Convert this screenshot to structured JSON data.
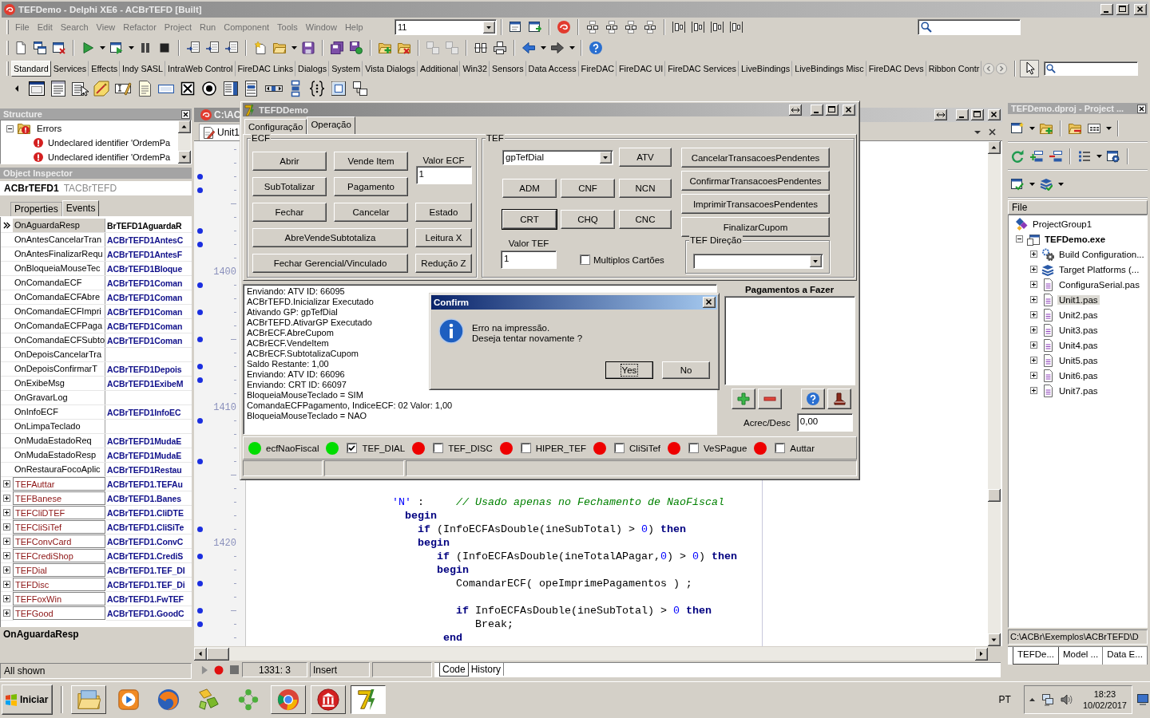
{
  "window": {
    "title": "TEFDemo - Delphi XE6 - ACBrTEFD [Built]"
  },
  "menu": [
    {
      "label": "File",
      "disabled": true
    },
    {
      "label": "Edit",
      "disabled": true
    },
    {
      "label": "Search",
      "disabled": true
    },
    {
      "label": "View",
      "disabled": true
    },
    {
      "label": "Refactor",
      "disabled": true
    },
    {
      "label": "Project",
      "disabled": true
    },
    {
      "label": "Run",
      "disabled": true
    },
    {
      "label": "Component",
      "disabled": true
    },
    {
      "label": "Tools",
      "disabled": true
    },
    {
      "label": "Window",
      "disabled": true
    },
    {
      "label": "Help",
      "disabled": true
    }
  ],
  "toolbar": {
    "build_combo": "11"
  },
  "palette": {
    "tabs": [
      {
        "label": "Standard",
        "selected": true
      },
      {
        "label": "Services",
        "selected": false
      },
      {
        "label": "Effects",
        "selected": false
      },
      {
        "label": "Indy SASL",
        "selected": false
      },
      {
        "label": "IntraWeb Control",
        "selected": false
      },
      {
        "label": "FireDAC Links",
        "selected": false
      },
      {
        "label": "Dialogs",
        "selected": false
      },
      {
        "label": "System",
        "selected": false
      },
      {
        "label": "Vista Dialogs",
        "selected": false
      },
      {
        "label": "Additional",
        "selected": false
      },
      {
        "label": "Win32",
        "selected": false
      },
      {
        "label": "Sensors",
        "selected": false
      },
      {
        "label": "Data Access",
        "selected": false
      },
      {
        "label": "FireDAC",
        "selected": false
      },
      {
        "label": "FireDAC UI",
        "selected": false
      },
      {
        "label": "FireDAC Services",
        "selected": false
      },
      {
        "label": "LiveBindings",
        "selected": false
      },
      {
        "label": "LiveBindings Misc",
        "selected": false
      },
      {
        "label": "FireDAC Devs",
        "selected": false
      },
      {
        "label": "Ribbon Contr",
        "selected": false
      }
    ]
  },
  "structure": {
    "title": "Structure",
    "tree": [
      {
        "label": "Errors",
        "expanded": true,
        "children": [
          {
            "label": "Undeclared identifier 'OrdemPa"
          },
          {
            "label": "Undeclared identifier 'OrdemPa"
          }
        ]
      }
    ]
  },
  "object_inspector": {
    "title": "Object Inspector",
    "component": "ACBrTEFD1",
    "component_class": "TACBrTEFD",
    "tabs": [
      {
        "label": "Properties",
        "selected": false
      },
      {
        "label": "Events",
        "selected": true
      }
    ],
    "rows": [
      {
        "kind": "event",
        "name": "OnAguardaResp",
        "value": "BrTEFD1AguardaR",
        "selected": true
      },
      {
        "kind": "event",
        "name": "OnAntesCancelarTran",
        "value": "ACBrTEFD1AntesC",
        "selected": false
      },
      {
        "kind": "event",
        "name": "OnAntesFinalizarRequ",
        "value": "ACBrTEFD1AntesF",
        "selected": false
      },
      {
        "kind": "event",
        "name": "OnBloqueiaMouseTec",
        "value": "ACBrTEFD1Bloque",
        "selected": false
      },
      {
        "kind": "event",
        "name": "OnComandaECF",
        "value": "ACBrTEFD1Coman",
        "selected": false
      },
      {
        "kind": "event",
        "name": "OnComandaECFAbre",
        "value": "ACBrTEFD1Coman",
        "selected": false
      },
      {
        "kind": "event",
        "name": "OnComandaECFImpri",
        "value": "ACBrTEFD1Coman",
        "selected": false
      },
      {
        "kind": "event",
        "name": "OnComandaECFPaga",
        "value": "ACBrTEFD1Coman",
        "selected": false
      },
      {
        "kind": "event",
        "name": "OnComandaECFSubto",
        "value": "ACBrTEFD1Coman",
        "selected": false
      },
      {
        "kind": "event",
        "name": "OnDepoisCancelarTra",
        "selected": false
      },
      {
        "kind": "event",
        "name": "OnDepoisConfirmarT",
        "value": "ACBrTEFD1Depois",
        "selected": false
      },
      {
        "kind": "event",
        "name": "OnExibeMsg",
        "value": "ACBrTEFD1ExibeM",
        "selected": false
      },
      {
        "kind": "event",
        "name": "OnGravarLog",
        "selected": false
      },
      {
        "kind": "event",
        "name": "OnInfoECF",
        "value": "ACBrTEFD1InfoEC",
        "selected": false
      },
      {
        "kind": "event",
        "name": "OnLimpaTeclado",
        "selected": false
      },
      {
        "kind": "event",
        "name": "OnMudaEstadoReq",
        "value": "ACBrTEFD1MudaE",
        "selected": false
      },
      {
        "kind": "event",
        "name": "OnMudaEstadoResp",
        "value": "ACBrTEFD1MudaE",
        "selected": false
      },
      {
        "kind": "event",
        "name": "OnRestauraFocoAplic",
        "value": "ACBrTEFD1Restau",
        "selected": false
      },
      {
        "kind": "group",
        "name": "TEFAuttar",
        "value": "ACBrTEFD1.TEFAu",
        "expanded": false,
        "selected": false
      },
      {
        "kind": "group",
        "name": "TEFBanese",
        "value": "ACBrTEFD1.Banes",
        "expanded": false,
        "selected": false
      },
      {
        "kind": "group",
        "name": "TEFCliDTEF",
        "value": "ACBrTEFD1.CliDTE",
        "expanded": false,
        "selected": false
      },
      {
        "kind": "group",
        "name": "TEFCliSiTef",
        "value": "ACBrTEFD1.CliSiTe",
        "expanded": false,
        "selected": false
      },
      {
        "kind": "group",
        "name": "TEFConvCard",
        "value": "ACBrTEFD1.ConvC",
        "expanded": false,
        "selected": false
      },
      {
        "kind": "group",
        "name": "TEFCrediShop",
        "value": "ACBrTEFD1.CrediS",
        "expanded": false,
        "selected": false
      },
      {
        "kind": "group",
        "name": "TEFDial",
        "value": "ACBrTEFD1.TEF_DI",
        "expanded": false,
        "selected": false
      },
      {
        "kind": "group",
        "name": "TEFDisc",
        "value": "ACBrTEFD1.TEF_Di",
        "expanded": false,
        "selected": false
      },
      {
        "kind": "group",
        "name": "TEFFoxWin",
        "value": "ACBrTEFD1.FwTEF",
        "expanded": false,
        "selected": false
      },
      {
        "kind": "group",
        "name": "TEFGood",
        "value": "ACBrTEFD1.GoodC",
        "expanded": false,
        "selected": false
      }
    ],
    "description": "OnAguardaResp",
    "status": "All shown"
  },
  "editor": {
    "title": "C:\\AC",
    "tabs": [
      {
        "label": "Unit1",
        "selected": true
      }
    ],
    "lines": [
      {
        "kind": "tick",
        "dot": false
      },
      {
        "kind": "tick",
        "dot": false
      },
      {
        "kind": "tick",
        "dot": true
      },
      {
        "kind": "tick",
        "dot": true
      },
      {
        "kind": "long_tick",
        "dot": false
      },
      {
        "kind": "tick",
        "dot": false
      },
      {
        "kind": "tick",
        "dot": true
      },
      {
        "kind": "tick",
        "dot": true
      },
      {
        "kind": "tick",
        "dot": false
      },
      {
        "kind": "number",
        "number": "1400",
        "dot": false
      },
      {
        "kind": "tick",
        "dot": true
      },
      {
        "kind": "tick",
        "dot": false
      },
      {
        "kind": "tick",
        "dot": true
      },
      {
        "kind": "tick",
        "dot": false
      },
      {
        "kind": "long_tick",
        "dot": true
      },
      {
        "kind": "tick",
        "dot": false
      },
      {
        "kind": "tick",
        "dot": true
      },
      {
        "kind": "tick",
        "dot": true
      },
      {
        "kind": "tick",
        "dot": false
      },
      {
        "kind": "number",
        "number": "1410",
        "dot": false
      },
      {
        "kind": "tick",
        "dot": true
      },
      {
        "kind": "tick",
        "dot": false
      },
      {
        "kind": "tick",
        "dot": false
      },
      {
        "kind": "tick",
        "dot": true
      },
      {
        "kind": "long_tick",
        "dot": false
      },
      {
        "kind": "tick",
        "dot": false
      },
      {
        "kind": "tick",
        "dot": false,
        "code": [
          {
            "kind": "string",
            "text": "                      'N'"
          },
          {
            "kind": "plain",
            "text": " :     "
          },
          {
            "kind": "comment",
            "text": "// Usado apenas no Fechamento de NaoFiscal"
          }
        ]
      },
      {
        "kind": "tick",
        "dot": false,
        "code": [
          {
            "kind": "keyword",
            "text": "                        begin"
          }
        ]
      },
      {
        "kind": "tick",
        "dot": true,
        "code": [
          {
            "kind": "keyword",
            "text": "                          if"
          },
          {
            "kind": "plain",
            "text": " (InfoECFAsDouble(ineSubTotal) > "
          },
          {
            "kind": "number",
            "text": "0"
          },
          {
            "kind": "plain",
            "text": ") "
          },
          {
            "kind": "keyword",
            "text": "then"
          }
        ]
      },
      {
        "kind": "number",
        "number": "1420",
        "dot": false,
        "code": [
          {
            "kind": "keyword",
            "text": "                          begin"
          }
        ]
      },
      {
        "kind": "tick",
        "dot": true,
        "code": [
          {
            "kind": "keyword",
            "text": "                             if"
          },
          {
            "kind": "plain",
            "text": " (InfoECFAsDouble(ineTotalAPagar,"
          },
          {
            "kind": "number",
            "text": "0"
          },
          {
            "kind": "plain",
            "text": ") > "
          },
          {
            "kind": "number",
            "text": "0"
          },
          {
            "kind": "plain",
            "text": ") "
          },
          {
            "kind": "keyword",
            "text": "then"
          }
        ]
      },
      {
        "kind": "tick",
        "dot": false,
        "code": [
          {
            "kind": "keyword",
            "text": "                             begin"
          }
        ]
      },
      {
        "kind": "tick",
        "dot": true,
        "code": [
          {
            "kind": "plain",
            "text": "                                ComandarECF( opeImprimePagamentos ) ;"
          }
        ]
      },
      {
        "kind": "tick",
        "dot": false
      },
      {
        "kind": "long_tick",
        "dot": true,
        "code": [
          {
            "kind": "keyword",
            "text": "                                if"
          },
          {
            "kind": "plain",
            "text": " InfoECFAsDouble(ineSubTotal) > "
          },
          {
            "kind": "number",
            "text": "0"
          },
          {
            "kind": "keyword",
            "text": " then"
          }
        ]
      },
      {
        "kind": "tick",
        "dot": true,
        "code": [
          {
            "kind": "plain",
            "text": "                                   Break;"
          }
        ]
      },
      {
        "kind": "tick",
        "dot": false,
        "code": [
          {
            "kind": "keyword",
            "text": "                              end"
          }
        ]
      }
    ],
    "status": {
      "position": "1331: 3",
      "mode": "Insert"
    },
    "view_tabs": [
      {
        "label": "Code",
        "selected": true
      },
      {
        "label": "History",
        "selected": false
      }
    ]
  },
  "project_manager": {
    "title": "TEFDemo.dproj - Project ...",
    "column": "File",
    "tree": [
      {
        "label": "ProjectGroup1",
        "kind": "group",
        "selected": false,
        "children": [
          {
            "label": "TEFDemo.exe",
            "kind": "project",
            "expanded": true,
            "selected": false,
            "children": [
              {
                "label": "Build Configuration...",
                "kind": "build",
                "expanded": false,
                "selected": false
              },
              {
                "label": "Target Platforms (...",
                "kind": "platforms",
                "expanded": false,
                "selected": false
              },
              {
                "label": "ConfiguraSerial.pas",
                "kind": "unit",
                "expanded": false,
                "selected": false
              },
              {
                "label": "Unit1.pas",
                "kind": "unit",
                "expanded": false,
                "selected": true
              },
              {
                "label": "Unit2.pas",
                "kind": "unit",
                "expanded": false,
                "selected": false
              },
              {
                "label": "Unit3.pas",
                "kind": "unit",
                "expanded": false,
                "selected": false
              },
              {
                "label": "Unit4.pas",
                "kind": "unit",
                "expanded": false,
                "selected": false
              },
              {
                "label": "Unit5.pas",
                "kind": "unit",
                "expanded": false,
                "selected": false
              },
              {
                "label": "Unit6.pas",
                "kind": "unit",
                "expanded": false,
                "selected": false
              },
              {
                "label": "Unit7.pas",
                "kind": "unit",
                "expanded": false,
                "selected": false
              }
            ]
          }
        ]
      }
    ],
    "path": "C:\\ACBr\\Exemplos\\ACBrTEFD\\D",
    "tabs": [
      {
        "label": "TEFDe...",
        "selected": true
      },
      {
        "label": "Model ...",
        "selected": false
      },
      {
        "label": "Data E...",
        "selected": false
      }
    ]
  },
  "tefd_window": {
    "title": "TEFDDemo",
    "tabs": [
      {
        "label": "Configuração",
        "selected": false
      },
      {
        "label": "Operação",
        "selected": true
      }
    ],
    "ecf": {
      "title": "ECF",
      "buttons": [
        "Abrir",
        "Vende Item",
        "SubTotalizar",
        "Pagamento",
        "Fechar",
        "Cancelar",
        "Estado",
        "AbreVendeSubtotaliza",
        "Leitura X",
        "Fechar Gerencial/Vinculado",
        "Redução Z"
      ],
      "valor_label": "Valor ECF",
      "valor": "1"
    },
    "tef": {
      "title": "TEF",
      "gp": "gpTefDial",
      "buttons": [
        {
          "label": "ATV",
          "focused": false
        },
        {
          "label": "ADM",
          "focused": false
        },
        {
          "label": "CNF",
          "focused": false
        },
        {
          "label": "NCN",
          "focused": false
        },
        {
          "label": "CRT",
          "focused": true
        },
        {
          "label": "CHQ",
          "focused": false
        },
        {
          "label": "CNC",
          "focused": false
        }
      ],
      "valor_label": "Valor TEF",
      "valor": "1",
      "multiplos": {
        "label": "Multiplos Cartões",
        "checked": false
      },
      "actions": [
        "CancelarTransacoesPendentes",
        "ConfirmarTransacoesPendentes",
        "ImprimirTransacoesPendentes",
        "FinalizarCupom"
      ],
      "direcao_title": "TEF Direção"
    },
    "log": [
      "Enviando: ATV ID: 66095",
      "ACBrTEFD.Inicializar Executado",
      "Ativando GP: gpTefDial",
      "ACBrTEFD.AtivarGP Executado",
      "ACBrECF.AbreCupom",
      "ACBrECF.VendeItem",
      "ACBrECF.SubtotalizaCupom",
      "Saldo Restante: 1,00",
      "Enviando: ATV ID: 66096",
      "Enviando: CRT ID: 66097",
      "BloqueiaMouseTeclado = SIM",
      "ComandaECFPagamento, IndiceECF: 02 Valor: 1,00",
      "BloqueiaMouseTeclado = NAO"
    ],
    "pagamentos": {
      "title": "Pagamentos a Fazer",
      "acrec_label": "Acrec/Desc",
      "acrec": "0,00"
    },
    "gp_status": [
      {
        "kind": "indicator",
        "label": "ecfNaoFiscal",
        "color": "#00dd00"
      },
      {
        "kind": "gp",
        "label": "TEF_DIAL",
        "color": "#00dd00",
        "checked": true
      },
      {
        "kind": "gp",
        "label": "TEF_DISC",
        "color": "#ee0000",
        "checked": false
      },
      {
        "kind": "gp",
        "label": "HIPER_TEF",
        "color": "#ee0000",
        "checked": false
      },
      {
        "kind": "gp",
        "label": "CliSiTef",
        "color": "#ee0000",
        "checked": false
      },
      {
        "kind": "gp",
        "label": "VeSPague",
        "color": "#ee0000",
        "checked": false
      },
      {
        "kind": "gp",
        "label": "Auttar",
        "color": "#ee0000",
        "checked": false
      }
    ]
  },
  "confirm": {
    "title": "Confirm",
    "message": [
      "Erro na impressão.",
      "Deseja tentar novamente ?"
    ],
    "buttons": [
      {
        "label": "Yes",
        "focused": true
      },
      {
        "label": "No",
        "focused": false
      }
    ]
  },
  "taskbar": {
    "start": "Iniciar",
    "apps": [
      {
        "running": true,
        "selected": false
      },
      {
        "running": false,
        "selected": false
      },
      {
        "running": false,
        "selected": false
      },
      {
        "running": false,
        "selected": false
      },
      {
        "running": false,
        "selected": false
      },
      {
        "running": true,
        "selected": false
      },
      {
        "running": true,
        "selected": false
      },
      {
        "running": true,
        "selected": true
      }
    ],
    "language": "PT",
    "time": "18:23",
    "date": "10/02/2017"
  }
}
